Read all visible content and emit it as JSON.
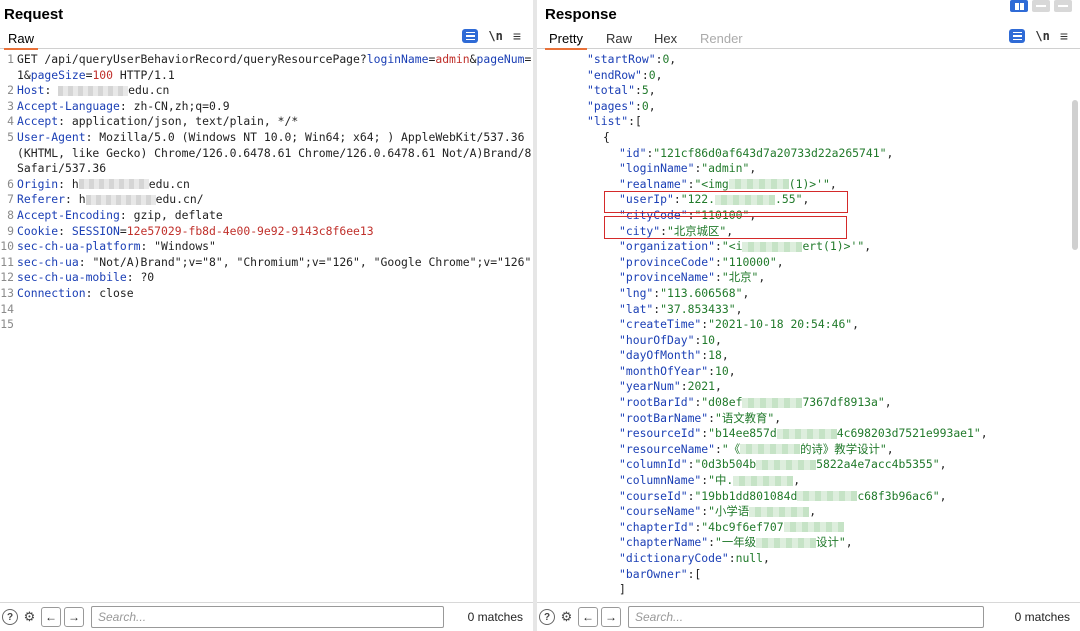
{
  "request": {
    "title": "Request",
    "tabs": [
      "Raw"
    ],
    "lines": [
      {
        "n": "1",
        "parts": [
          [
            "t",
            "GET /api/queryUserBehaviorRecord/queryResourcePage?"
          ],
          [
            "k",
            "loginName"
          ],
          [
            "t",
            "="
          ],
          [
            "v",
            "admin"
          ],
          [
            "t",
            "&"
          ],
          [
            "k",
            "pageNum"
          ],
          [
            "t",
            "=1&"
          ],
          [
            "k",
            "pageSize"
          ],
          [
            "t",
            "="
          ],
          [
            "v",
            "100"
          ],
          [
            "t",
            " HTTP/1.1"
          ]
        ]
      },
      {
        "n": "2",
        "parts": [
          [
            "k",
            "Host"
          ],
          [
            "t",
            ": "
          ],
          [
            "blur",
            "ma"
          ],
          [
            "t",
            "edu.cn"
          ]
        ]
      },
      {
        "n": "3",
        "parts": [
          [
            "k",
            "Accept-Language"
          ],
          [
            "t",
            ": zh-CN,zh;q=0.9"
          ]
        ]
      },
      {
        "n": "4",
        "parts": [
          [
            "k",
            "Accept"
          ],
          [
            "t",
            ": application/json, text/plain, */*"
          ]
        ]
      },
      {
        "n": "5",
        "parts": [
          [
            "k",
            "User-Agent"
          ],
          [
            "t",
            ": Mozilla/5.0 (Windows NT 10.0; Win64; x64; ) AppleWebKit/537.36 (KHTML, like Gecko) Chrome/126.0.6478.61 Chrome/126.0.6478.61 Not/A)Brand/8  Safari/537.36"
          ]
        ]
      },
      {
        "n": "6",
        "parts": [
          [
            "k",
            "Origin"
          ],
          [
            "t",
            ": h"
          ],
          [
            "blur",
            "ttp"
          ],
          [
            "t",
            "edu.cn"
          ]
        ]
      },
      {
        "n": "7",
        "parts": [
          [
            "k",
            "Referer"
          ],
          [
            "t",
            ": h"
          ],
          [
            "blur",
            "ttp"
          ],
          [
            "t",
            "edu.cn/"
          ]
        ]
      },
      {
        "n": "8",
        "parts": [
          [
            "k",
            "Accept-Encoding"
          ],
          [
            "t",
            ": gzip, deflate"
          ]
        ]
      },
      {
        "n": "9",
        "parts": [
          [
            "k",
            "Cookie"
          ],
          [
            "t",
            ": "
          ],
          [
            "k",
            "SESSION"
          ],
          [
            "t",
            "="
          ],
          [
            "v",
            "12e57029-fb8d-4e00-9e92-9143c8f6ee13"
          ]
        ]
      },
      {
        "n": "10",
        "parts": [
          [
            "k",
            "sec-ch-ua-platform"
          ],
          [
            "t",
            ": \"Windows\""
          ]
        ]
      },
      {
        "n": "11",
        "parts": [
          [
            "k",
            "sec-ch-ua"
          ],
          [
            "t",
            ": \"Not/A)Brand\";v=\"8\", \"Chromium\";v=\"126\", \"Google Chrome\";v=\"126\""
          ]
        ]
      },
      {
        "n": "12",
        "parts": [
          [
            "k",
            "sec-ch-ua-mobile"
          ],
          [
            "t",
            ": ?0"
          ]
        ]
      },
      {
        "n": "13",
        "parts": [
          [
            "k",
            "Connection"
          ],
          [
            "t",
            ": close"
          ]
        ]
      },
      {
        "n": "14",
        "parts": []
      },
      {
        "n": "15",
        "parts": []
      }
    ],
    "search_placeholder": "Search...",
    "matches": "0 matches"
  },
  "response": {
    "title": "Response",
    "tabs": [
      "Pretty",
      "Raw",
      "Hex",
      "Render"
    ],
    "lines": [
      {
        "i": 2,
        "parts": [
          [
            "k",
            "\"startRow\""
          ],
          [
            "t",
            ":"
          ],
          [
            "n",
            "0"
          ],
          [
            "t",
            ","
          ]
        ]
      },
      {
        "i": 2,
        "parts": [
          [
            "k",
            "\"endRow\""
          ],
          [
            "t",
            ":"
          ],
          [
            "n",
            "0"
          ],
          [
            "t",
            ","
          ]
        ]
      },
      {
        "i": 2,
        "parts": [
          [
            "k",
            "\"total\""
          ],
          [
            "t",
            ":"
          ],
          [
            "n",
            "5"
          ],
          [
            "t",
            ","
          ]
        ]
      },
      {
        "i": 2,
        "parts": [
          [
            "k",
            "\"pages\""
          ],
          [
            "t",
            ":"
          ],
          [
            "n",
            "0"
          ],
          [
            "t",
            ","
          ]
        ]
      },
      {
        "i": 2,
        "parts": [
          [
            "k",
            "\"list\""
          ],
          [
            "t",
            ":["
          ]
        ]
      },
      {
        "i": 3,
        "parts": [
          [
            "t",
            "{"
          ]
        ]
      },
      {
        "i": 4,
        "parts": [
          [
            "k",
            "\"id\""
          ],
          [
            "t",
            ":"
          ],
          [
            "s",
            "\"121cf86d0af643d7a20733d22a265741\""
          ],
          [
            "t",
            ","
          ]
        ]
      },
      {
        "i": 4,
        "parts": [
          [
            "k",
            "\"loginName\""
          ],
          [
            "t",
            ":"
          ],
          [
            "s",
            "\"admin\""
          ],
          [
            "t",
            ","
          ]
        ]
      },
      {
        "i": 4,
        "parts": [
          [
            "k",
            "\"realname\""
          ],
          [
            "t",
            ":"
          ],
          [
            "s",
            "\"<img"
          ],
          [
            "blur",
            ""
          ],
          [
            "s",
            "(1)>'\""
          ],
          [
            "t",
            ","
          ]
        ]
      },
      {
        "i": 4,
        "parts": [
          [
            "k",
            "\"userIp\""
          ],
          [
            "t",
            ":"
          ],
          [
            "s",
            "\"122."
          ],
          [
            "blur",
            ""
          ],
          [
            "s",
            ".55\""
          ],
          [
            "t",
            ","
          ]
        ]
      },
      {
        "i": 4,
        "parts": [
          [
            "k",
            "\"cityCode\""
          ],
          [
            "t",
            ":"
          ],
          [
            "s",
            "\"110100\""
          ],
          [
            "t",
            ","
          ]
        ]
      },
      {
        "i": 4,
        "parts": [
          [
            "k",
            "\"city\""
          ],
          [
            "t",
            ":"
          ],
          [
            "s",
            "\"北京城区\""
          ],
          [
            "t",
            ","
          ]
        ]
      },
      {
        "i": 4,
        "parts": [
          [
            "k",
            "\"organization\""
          ],
          [
            "t",
            ":"
          ],
          [
            "s",
            "\"<i"
          ],
          [
            "blur",
            ""
          ],
          [
            "s",
            "ert(1)>'\""
          ],
          [
            "t",
            ","
          ]
        ]
      },
      {
        "i": 4,
        "parts": [
          [
            "k",
            "\"provinceCode\""
          ],
          [
            "t",
            ":"
          ],
          [
            "s",
            "\"110000\""
          ],
          [
            "t",
            ","
          ]
        ]
      },
      {
        "i": 4,
        "parts": [
          [
            "k",
            "\"provinceName\""
          ],
          [
            "t",
            ":"
          ],
          [
            "s",
            "\"北京\""
          ],
          [
            "t",
            ","
          ]
        ]
      },
      {
        "i": 4,
        "parts": [
          [
            "k",
            "\"lng\""
          ],
          [
            "t",
            ":"
          ],
          [
            "s",
            "\"113.606568\""
          ],
          [
            "t",
            ","
          ]
        ]
      },
      {
        "i": 4,
        "parts": [
          [
            "k",
            "\"lat\""
          ],
          [
            "t",
            ":"
          ],
          [
            "s",
            "\"37.853433\""
          ],
          [
            "t",
            ","
          ]
        ]
      },
      {
        "i": 4,
        "parts": [
          [
            "k",
            "\"createTime\""
          ],
          [
            "t",
            ":"
          ],
          [
            "s",
            "\"2021-10-18 20:54:46\""
          ],
          [
            "t",
            ","
          ]
        ]
      },
      {
        "i": 4,
        "parts": [
          [
            "k",
            "\"hourOfDay\""
          ],
          [
            "t",
            ":"
          ],
          [
            "n",
            "10"
          ],
          [
            "t",
            ","
          ]
        ]
      },
      {
        "i": 4,
        "parts": [
          [
            "k",
            "\"dayOfMonth\""
          ],
          [
            "t",
            ":"
          ],
          [
            "n",
            "18"
          ],
          [
            "t",
            ","
          ]
        ]
      },
      {
        "i": 4,
        "parts": [
          [
            "k",
            "\"monthOfYear\""
          ],
          [
            "t",
            ":"
          ],
          [
            "n",
            "10"
          ],
          [
            "t",
            ","
          ]
        ]
      },
      {
        "i": 4,
        "parts": [
          [
            "k",
            "\"yearNum\""
          ],
          [
            "t",
            ":"
          ],
          [
            "n",
            "2021"
          ],
          [
            "t",
            ","
          ]
        ]
      },
      {
        "i": 4,
        "parts": [
          [
            "k",
            "\"rootBarId\""
          ],
          [
            "t",
            ":"
          ],
          [
            "s",
            "\"d08ef"
          ],
          [
            "blur",
            ""
          ],
          [
            "s",
            "7367df8913a\""
          ],
          [
            "t",
            ","
          ]
        ]
      },
      {
        "i": 4,
        "parts": [
          [
            "k",
            "\"rootBarName\""
          ],
          [
            "t",
            ":"
          ],
          [
            "s",
            "\"语文教育\""
          ],
          [
            "t",
            ","
          ]
        ]
      },
      {
        "i": 4,
        "parts": [
          [
            "k",
            "\"resourceId\""
          ],
          [
            "t",
            ":"
          ],
          [
            "s",
            "\"b14ee857d"
          ],
          [
            "blur",
            ""
          ],
          [
            "s",
            "4c698203d7521e993ae1\""
          ],
          [
            "t",
            ","
          ]
        ]
      },
      {
        "i": 4,
        "parts": [
          [
            "k",
            "\"resourceName\""
          ],
          [
            "t",
            ":"
          ],
          [
            "s",
            "\"《"
          ],
          [
            "blur",
            ""
          ],
          [
            "s",
            "的诗》教学设计\""
          ],
          [
            "t",
            ","
          ]
        ]
      },
      {
        "i": 4,
        "parts": [
          [
            "k",
            "\"columnId\""
          ],
          [
            "t",
            ":"
          ],
          [
            "s",
            "\"0d3b504b"
          ],
          [
            "blur",
            ""
          ],
          [
            "s",
            "5822a4e7acc4b5355\""
          ],
          [
            "t",
            ","
          ]
        ]
      },
      {
        "i": 4,
        "parts": [
          [
            "k",
            "\"columnName\""
          ],
          [
            "t",
            ":"
          ],
          [
            "s",
            "\"中."
          ],
          [
            "blur",
            ""
          ],
          [
            "t",
            ","
          ]
        ]
      },
      {
        "i": 4,
        "parts": [
          [
            "k",
            "\"courseId\""
          ],
          [
            "t",
            ":"
          ],
          [
            "s",
            "\"19bb1dd801084d"
          ],
          [
            "blur",
            ""
          ],
          [
            "s",
            "c68f3b96ac6\""
          ],
          [
            "t",
            ","
          ]
        ]
      },
      {
        "i": 4,
        "parts": [
          [
            "k",
            "\"courseName\""
          ],
          [
            "t",
            ":"
          ],
          [
            "s",
            "\"小学语"
          ],
          [
            "blur",
            ""
          ],
          [
            "t",
            ","
          ]
        ]
      },
      {
        "i": 4,
        "parts": [
          [
            "k",
            "\"chapterId\""
          ],
          [
            "t",
            ":"
          ],
          [
            "s",
            "\"4bc9f6ef707"
          ],
          [
            "blur",
            ""
          ]
        ]
      },
      {
        "i": 4,
        "parts": [
          [
            "k",
            "\"chapterName\""
          ],
          [
            "t",
            ":"
          ],
          [
            "s",
            "\"一年级"
          ],
          [
            "blur",
            ""
          ],
          [
            "s",
            "设计\""
          ],
          [
            "t",
            ","
          ]
        ]
      },
      {
        "i": 4,
        "parts": [
          [
            "k",
            "\"dictionaryCode\""
          ],
          [
            "t",
            ":"
          ],
          [
            "n",
            "null"
          ],
          [
            "t",
            ","
          ]
        ]
      },
      {
        "i": 4,
        "parts": [
          [
            "k",
            "\"barOwner\""
          ],
          [
            "t",
            ":["
          ]
        ]
      },
      {
        "i": 4,
        "parts": [
          [
            "t",
            "]"
          ]
        ]
      }
    ],
    "search_placeholder": "Search...",
    "matches": "0 matches"
  },
  "colors": {
    "key": "#1b3fb5",
    "value": "#c0302b",
    "json_string": "#217a2b",
    "highlight": "#d42a2a",
    "accent": "#2f6bd6"
  },
  "icons": [
    "wrap-icon",
    "newline-icon",
    "menu-icon",
    "help-icon",
    "settings-icon",
    "arrow-left-icon",
    "arrow-right-icon",
    "layout-toggle-icon"
  ]
}
